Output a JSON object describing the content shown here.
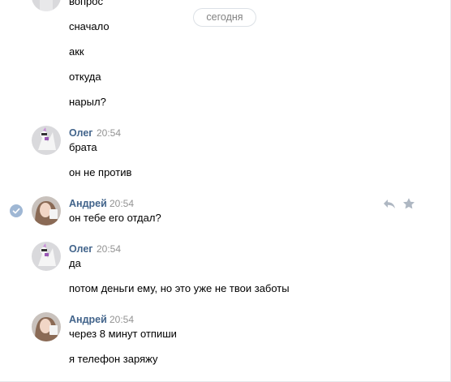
{
  "date_separator": "сегодня",
  "messages": [
    {
      "author": "",
      "time": "",
      "lines": [
        "вопрос",
        "сначало",
        "акк",
        "откуда",
        "нарыл?"
      ]
    },
    {
      "author": "Олег",
      "time": "20:54",
      "lines": [
        "брата",
        "он не против"
      ]
    },
    {
      "author": "Андрей",
      "time": "20:54",
      "lines": [
        "он тебе его отдал?"
      ]
    },
    {
      "author": "Олег",
      "time": "20:54",
      "lines": [
        "да",
        "потом деньги ему, но это уже не твои заботы"
      ]
    },
    {
      "author": "Андрей",
      "time": "20:54",
      "lines": [
        "через 8 минут отпиши",
        "я телефон заряжу"
      ]
    }
  ],
  "icons": {
    "selected": "check-circle-icon",
    "reply": "reply-icon",
    "favorite": "star-icon"
  },
  "colors": {
    "author_name": "#42648b",
    "timestamp": "#939393",
    "check_selected": "#9fb7d4",
    "action_icons": "#aeb7c2",
    "date_pill_border": "#dce1e6"
  }
}
